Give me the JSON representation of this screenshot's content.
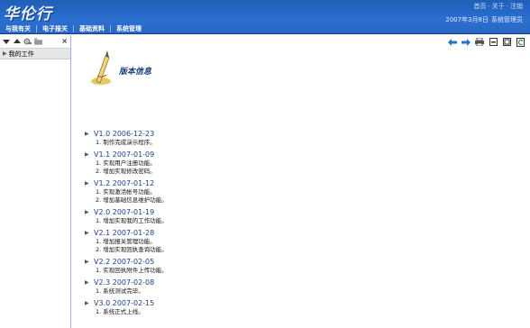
{
  "header": {
    "logo": "华伦行",
    "top_links": [
      "首页",
      "关于",
      "注销"
    ],
    "date": "2007年3月8日",
    "user": "系统管理员",
    "nav": [
      "与我有关",
      "电子报关",
      "基础资料",
      "系统管理"
    ]
  },
  "sidebar": {
    "tree": [
      {
        "label": "我的工作"
      }
    ]
  },
  "content": {
    "banner_title": "版本信息",
    "versions": [
      {
        "title": "V1.0 2006-12-23",
        "items": [
          "1. 制作完成演示程序。"
        ]
      },
      {
        "title": "V1.1 2007-01-09",
        "items": [
          "1. 实现用户注册功能。",
          "2. 增加实现修改密码。"
        ]
      },
      {
        "title": "V1.2 2007-01-12",
        "items": [
          "1. 实现激活帐号功能。",
          "2. 增加基础信息维护功能。"
        ]
      },
      {
        "title": "V2.0 2007-01-19",
        "items": [
          "1. 增加实现我的工作功能。"
        ]
      },
      {
        "title": "V2.1 2007-01-28",
        "items": [
          "1. 增加报关管理功能。",
          "2. 增加实现回执查询功能。"
        ]
      },
      {
        "title": "V2.2 2007-02-05",
        "items": [
          "1. 实现回执附件上传功能。"
        ]
      },
      {
        "title": "V2.3 2007-02-08",
        "items": [
          "1. 系统测试完毕。"
        ]
      },
      {
        "title": "V3.0 2007-02-15",
        "items": [
          "1. 系统正式上线。"
        ]
      }
    ]
  },
  "colors": {
    "header_blue": "#2c6fd0",
    "version_link": "#1c3f8f"
  }
}
